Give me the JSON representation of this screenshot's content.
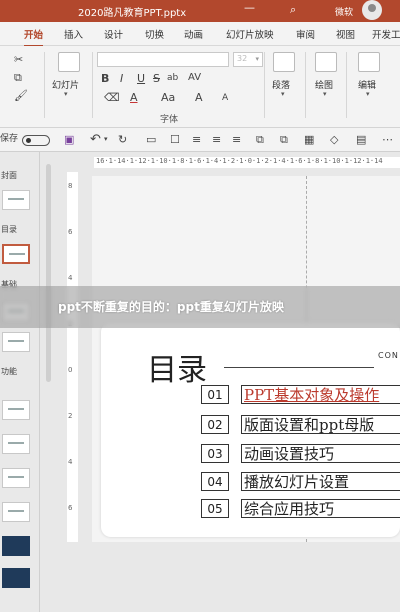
{
  "window": {
    "title": "2020路凡教育PPT.pptx",
    "user": "微软",
    "minimize_icon": "minimize-icon",
    "search_icon": "search-icon"
  },
  "tabs": [
    {
      "label": "开始",
      "active": true
    },
    {
      "label": "插入"
    },
    {
      "label": "设计"
    },
    {
      "label": "切换"
    },
    {
      "label": "动画"
    },
    {
      "label": "幻灯片放映"
    },
    {
      "label": "审阅"
    },
    {
      "label": "视图"
    },
    {
      "label": "开发工"
    }
  ],
  "ribbon": {
    "slides_button": "幻灯片",
    "font_group_label": "字体",
    "font_size": "32",
    "font_buttons": [
      "B",
      "I",
      "U",
      "S",
      "ab",
      "AV",
      "A",
      "Aa",
      "A",
      "A"
    ],
    "paragraph_button": "段落",
    "drawing_button": "绘图",
    "editing_button": "编辑"
  },
  "qat": {
    "autosave_label": "保存"
  },
  "slide_pane": {
    "sections": [
      "封面",
      "目录",
      "基础",
      "功能"
    ]
  },
  "ruler": {
    "horizontal": "16·1·14·1·12·1·10·1·8·1·6·1·4·1·2·1·0·1·2·1·4·1·6·1·8·1·10·1·12·1·14",
    "vertical": [
      "8",
      "6",
      "4",
      "2",
      "0",
      "2",
      "4",
      "6"
    ]
  },
  "slide": {
    "heading": "目录",
    "contents_label": "CON",
    "items": [
      {
        "num": "01",
        "text": "PPT基本对象及操作"
      },
      {
        "num": "02",
        "text": "版面设置和ppt母版"
      },
      {
        "num": "03",
        "text": "动画设置技巧"
      },
      {
        "num": "04",
        "text": "播放幻灯片设置"
      },
      {
        "num": "05",
        "text": "综合应用技巧"
      }
    ]
  },
  "banner": {
    "text": "ppt不断重复的目的：ppt重复幻灯片放映"
  },
  "colors": {
    "accent": "#b7472a",
    "highlight_text": "#c0392b"
  }
}
